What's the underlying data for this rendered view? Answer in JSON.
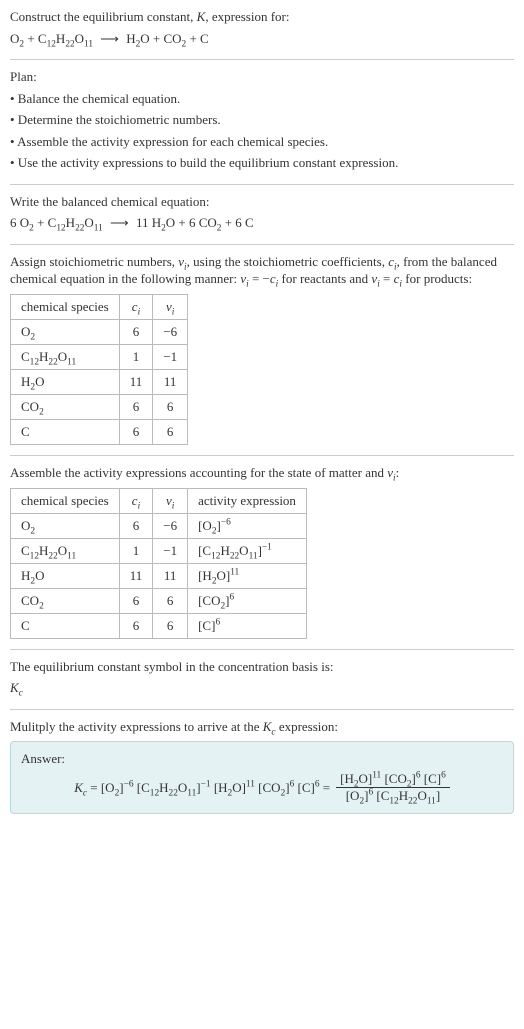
{
  "intro": {
    "line1": "Construct the equilibrium constant, <i>K</i>, expression for:",
    "equation": "O<sub>2</sub> + C<sub>12</sub>H<sub>22</sub>O<sub>11</sub> <span class='arrow'>⟶</span> H<sub>2</sub>O + CO<sub>2</sub> + C"
  },
  "plan": {
    "title": "Plan:",
    "b1": "• Balance the chemical equation.",
    "b2": "• Determine the stoichiometric numbers.",
    "b3": "• Assemble the activity expression for each chemical species.",
    "b4": "• Use the activity expressions to build the equilibrium constant expression."
  },
  "balanced": {
    "title": "Write the balanced chemical equation:",
    "equation": "6 O<sub>2</sub> + C<sub>12</sub>H<sub>22</sub>O<sub>11</sub> <span class='arrow'>⟶</span> 11 H<sub>2</sub>O + 6 CO<sub>2</sub> + 6 C"
  },
  "stoich": {
    "intro": "Assign stoichiometric numbers, <i>ν<sub>i</sub></i>, using the stoichiometric coefficients, <i>c<sub>i</sub></i>, from the balanced chemical equation in the following manner: <i>ν<sub>i</sub></i> = −<i>c<sub>i</sub></i> for reactants and <i>ν<sub>i</sub></i> = <i>c<sub>i</sub></i> for products:",
    "headers": {
      "h1": "chemical species",
      "h2": "<i>c<sub>i</sub></i>",
      "h3": "<i>ν<sub>i</sub></i>"
    },
    "rows": [
      {
        "s": "O<sub>2</sub>",
        "c": "6",
        "v": "−6"
      },
      {
        "s": "C<sub>12</sub>H<sub>22</sub>O<sub>11</sub>",
        "c": "1",
        "v": "−1"
      },
      {
        "s": "H<sub>2</sub>O",
        "c": "11",
        "v": "11"
      },
      {
        "s": "CO<sub>2</sub>",
        "c": "6",
        "v": "6"
      },
      {
        "s": "C",
        "c": "6",
        "v": "6"
      }
    ]
  },
  "activity": {
    "intro": "Assemble the activity expressions accounting for the state of matter and <i>ν<sub>i</sub></i>:",
    "headers": {
      "h1": "chemical species",
      "h2": "<i>c<sub>i</sub></i>",
      "h3": "<i>ν<sub>i</sub></i>",
      "h4": "activity expression"
    },
    "rows": [
      {
        "s": "O<sub>2</sub>",
        "c": "6",
        "v": "−6",
        "a": "[O<sub>2</sub>]<sup>−6</sup>"
      },
      {
        "s": "C<sub>12</sub>H<sub>22</sub>O<sub>11</sub>",
        "c": "1",
        "v": "−1",
        "a": "[C<sub>12</sub>H<sub>22</sub>O<sub>11</sub>]<sup>−1</sup>"
      },
      {
        "s": "H<sub>2</sub>O",
        "c": "11",
        "v": "11",
        "a": "[H<sub>2</sub>O]<sup>11</sup>"
      },
      {
        "s": "CO<sub>2</sub>",
        "c": "6",
        "v": "6",
        "a": "[CO<sub>2</sub>]<sup>6</sup>"
      },
      {
        "s": "C",
        "c": "6",
        "v": "6",
        "a": "[C]<sup>6</sup>"
      }
    ]
  },
  "symbol": {
    "line1": "The equilibrium constant symbol in the concentration basis is:",
    "line2": "<i>K<sub>c</sub></i>"
  },
  "final": {
    "intro": "Mulitply the activity expressions to arrive at the <i>K<sub>c</sub></i> expression:",
    "answer_label": "Answer:",
    "lhs": "<i>K<sub>c</sub></i> = [O<sub>2</sub>]<sup>−6</sup> [C<sub>12</sub>H<sub>22</sub>O<sub>11</sub>]<sup>−1</sup> [H<sub>2</sub>O]<sup>11</sup> [CO<sub>2</sub>]<sup>6</sup> [C]<sup>6</sup> =",
    "num": "[H<sub>2</sub>O]<sup>11</sup> [CO<sub>2</sub>]<sup>6</sup> [C]<sup>6</sup>",
    "den": "[O<sub>2</sub>]<sup>6</sup> [C<sub>12</sub>H<sub>22</sub>O<sub>11</sub>]"
  },
  "chart_data": {
    "type": "table",
    "tables": [
      {
        "title": "Stoichiometric numbers",
        "columns": [
          "chemical species",
          "c_i",
          "nu_i"
        ],
        "rows": [
          [
            "O2",
            6,
            -6
          ],
          [
            "C12H22O11",
            1,
            -1
          ],
          [
            "H2O",
            11,
            11
          ],
          [
            "CO2",
            6,
            6
          ],
          [
            "C",
            6,
            6
          ]
        ]
      },
      {
        "title": "Activity expressions",
        "columns": [
          "chemical species",
          "c_i",
          "nu_i",
          "activity expression"
        ],
        "rows": [
          [
            "O2",
            6,
            -6,
            "[O2]^-6"
          ],
          [
            "C12H22O11",
            1,
            -1,
            "[C12H22O11]^-1"
          ],
          [
            "H2O",
            11,
            11,
            "[H2O]^11"
          ],
          [
            "CO2",
            6,
            6,
            "[CO2]^6"
          ],
          [
            "C",
            6,
            6,
            "[C]^6"
          ]
        ]
      }
    ]
  }
}
